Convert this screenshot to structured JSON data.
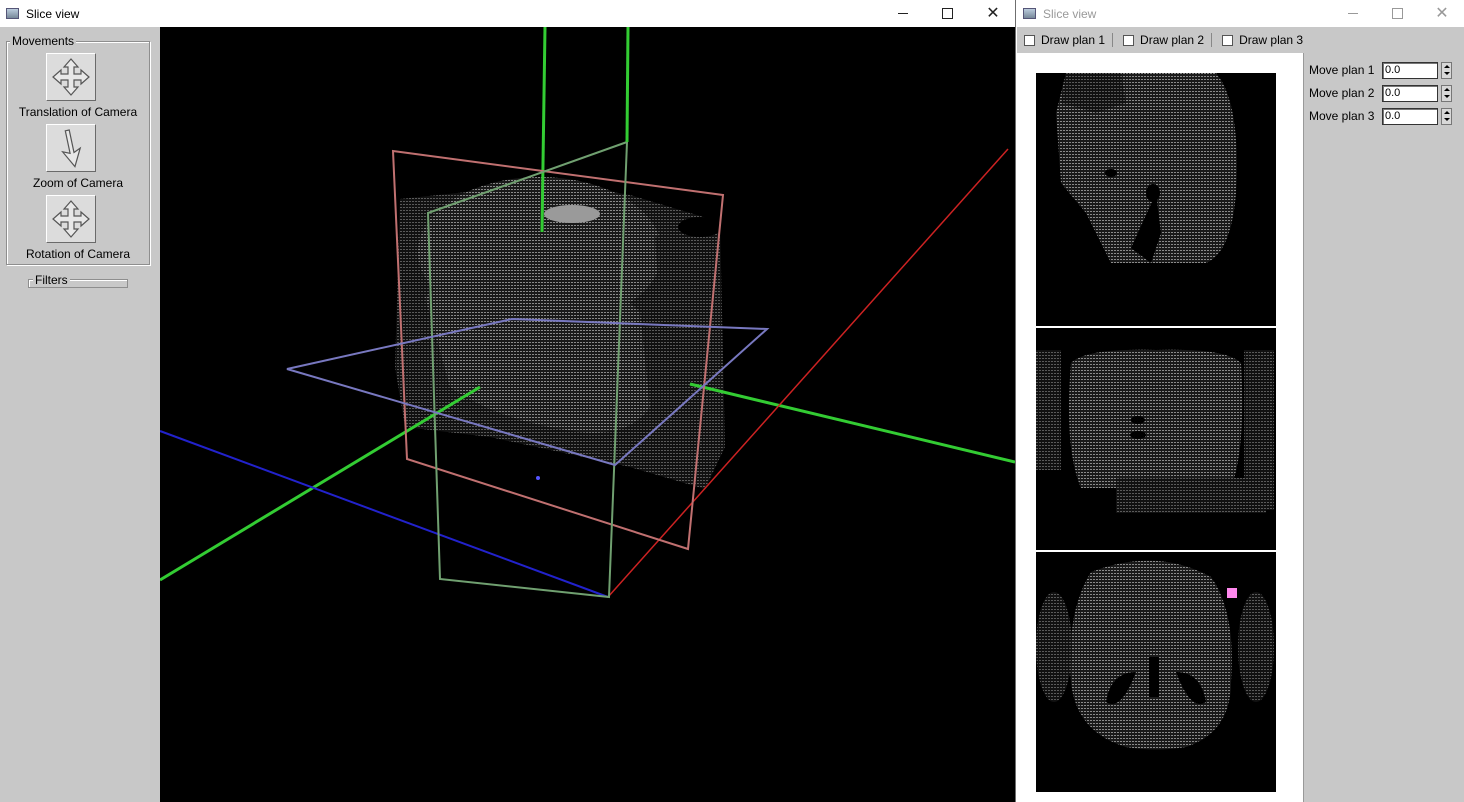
{
  "main_window": {
    "title": "Slice view",
    "movements": {
      "legend": "Movements",
      "buttons": [
        {
          "label": "Translation of Camera",
          "icon": "move-arrows-icon"
        },
        {
          "label": "Zoom of Camera",
          "icon": "zoom-arrow-icon"
        },
        {
          "label": "Rotation of Camera",
          "icon": "move-arrows-icon"
        }
      ]
    },
    "filters": {
      "legend": "Filters"
    }
  },
  "slice_window": {
    "title": "Slice view",
    "checkboxes": [
      {
        "label": "Draw plan 1",
        "checked": false
      },
      {
        "label": "Draw plan 2",
        "checked": false
      },
      {
        "label": "Draw plan 3",
        "checked": false
      }
    ],
    "move_plans": [
      {
        "label": "Move plan 1",
        "value": "0.0"
      },
      {
        "label": "Move plan 2",
        "value": "0.0"
      },
      {
        "label": "Move plan 3",
        "value": "0.0"
      }
    ]
  },
  "colors": {
    "panel_bg": "#c8c8c8",
    "axis_green": "#33cc33",
    "axis_red": "#cc2222",
    "axis_blue": "#2222cc",
    "plane_red": "#c07070",
    "plane_green": "#70a070",
    "plane_blue": "#7878c0",
    "marker_pink": "#ff88ee"
  }
}
